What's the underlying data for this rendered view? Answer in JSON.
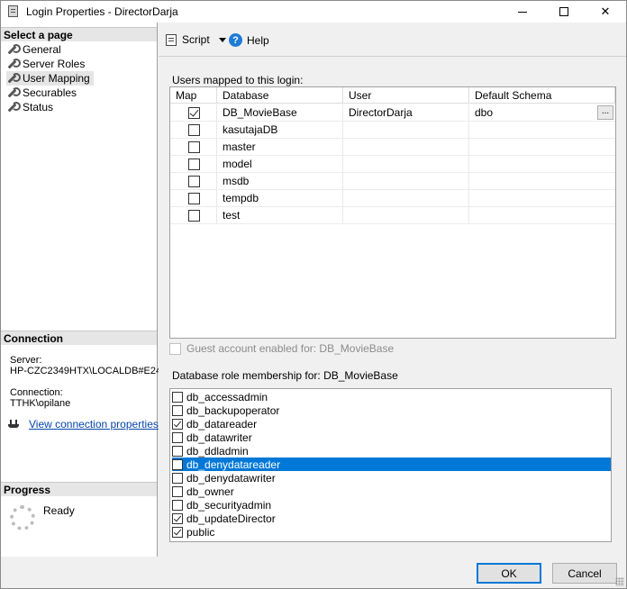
{
  "window": {
    "title": "Login Properties - DirectorDarja"
  },
  "left": {
    "select_header": "Select a page",
    "pages": [
      "General",
      "Server Roles",
      "User Mapping",
      "Securables",
      "Status"
    ],
    "connection_header": "Connection",
    "server_label": "Server:",
    "server_value": "HP-CZC2349HTX\\LOCALDB#E24",
    "connection_label": "Connection:",
    "connection_value": "TTHK\\opilane",
    "view_link": "View connection properties",
    "progress_header": "Progress",
    "progress_status": "Ready"
  },
  "toolbar": {
    "script_label": "Script",
    "help_label": "Help"
  },
  "users": {
    "label": "Users mapped to this login:",
    "columns": [
      "Map",
      "Database",
      "User",
      "Default Schema"
    ],
    "rows": [
      {
        "map": true,
        "database": "DB_MovieBase",
        "user": "DirectorDarja",
        "schema": "dbo",
        "button": "..."
      },
      {
        "map": false,
        "database": "kasutajaDB",
        "user": "",
        "schema": ""
      },
      {
        "map": false,
        "database": "master",
        "user": "",
        "schema": ""
      },
      {
        "map": false,
        "database": "model",
        "user": "",
        "schema": ""
      },
      {
        "map": false,
        "database": "msdb",
        "user": "",
        "schema": ""
      },
      {
        "map": false,
        "database": "tempdb",
        "user": "",
        "schema": ""
      },
      {
        "map": false,
        "database": "test",
        "user": "",
        "schema": ""
      }
    ]
  },
  "guest": {
    "label": "Guest account enabled for: DB_MovieBase",
    "checked": false
  },
  "roles": {
    "label": "Database role membership for: DB_MovieBase",
    "items": [
      {
        "name": "db_accessadmin",
        "checked": false
      },
      {
        "name": "db_backupoperator",
        "checked": false
      },
      {
        "name": "db_datareader",
        "checked": true
      },
      {
        "name": "db_datawriter",
        "checked": false
      },
      {
        "name": "db_ddladmin",
        "checked": false
      },
      {
        "name": "db_denydatareader",
        "checked": false,
        "selected": true
      },
      {
        "name": "db_denydatawriter",
        "checked": false
      },
      {
        "name": "db_owner",
        "checked": false
      },
      {
        "name": "db_securityadmin",
        "checked": false
      },
      {
        "name": "db_updateDirector",
        "checked": true
      },
      {
        "name": "public",
        "checked": true
      }
    ]
  },
  "buttons": {
    "ok": "OK",
    "cancel": "Cancel"
  }
}
